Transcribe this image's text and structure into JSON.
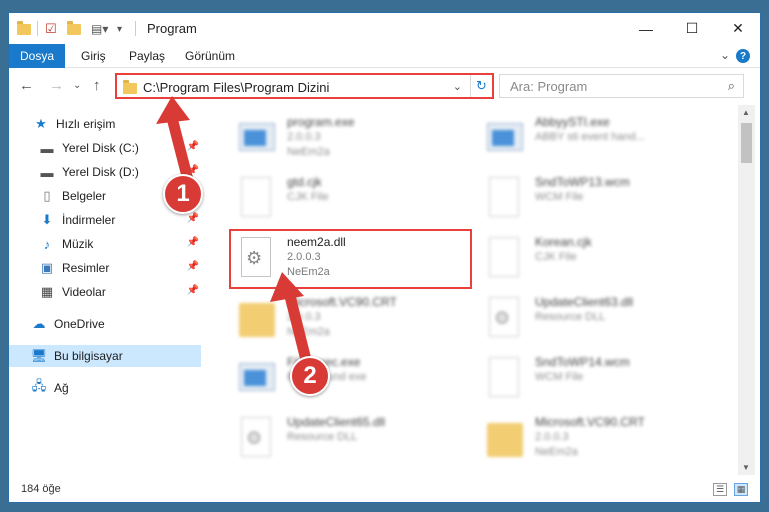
{
  "window": {
    "title": "Program"
  },
  "ribbon": {
    "tabs": [
      "Dosya",
      "Giriş",
      "Paylaş",
      "Görünüm"
    ],
    "help": "?"
  },
  "navbar": {
    "address": "C:\\Program Files\\Program Dizini",
    "search_placeholder": "Ara: Program"
  },
  "sidebar": {
    "items": [
      {
        "label": "Hızlı erişim",
        "icon": "star-icon"
      },
      {
        "label": "Yerel Disk (C:)",
        "icon": "drive-icon"
      },
      {
        "label": "Yerel Disk (D:)",
        "icon": "drive-icon"
      },
      {
        "label": "Belgeler",
        "icon": "document-icon"
      },
      {
        "label": "İndirmeler",
        "icon": "download-icon"
      },
      {
        "label": "Müzik",
        "icon": "music-icon"
      },
      {
        "label": "Resimler",
        "icon": "picture-icon"
      },
      {
        "label": "Videolar",
        "icon": "video-icon"
      },
      {
        "label": "OneDrive",
        "icon": "cloud-icon"
      },
      {
        "label": "Bu bilgisayar",
        "icon": "computer-icon"
      },
      {
        "label": "Ağ",
        "icon": "network-icon"
      }
    ]
  },
  "files": {
    "left": [
      {
        "name": "program.exe",
        "l2": "2.0.0.3",
        "l3": "NeEm2a"
      },
      {
        "name": "gtd.cjk",
        "l2": "CJK File",
        "l3": ""
      },
      {
        "name": "neem2a.dll",
        "l2": "2.0.0.3",
        "l3": "NeEm2a"
      },
      {
        "name": "Microsoft.VC90.CRT",
        "l2": "2.0.0.3",
        "l3": "NeEm2a"
      },
      {
        "name": "Filesexec.exe",
        "l2": "Background exe",
        "l3": ""
      },
      {
        "name": "UpdateClient65.dll",
        "l2": "Resource DLL",
        "l3": ""
      }
    ],
    "right": [
      {
        "name": "AbbyySTI.exe",
        "l2": "ABBY sti event hand...",
        "l3": ""
      },
      {
        "name": "SndToWP13.wcm",
        "l2": "WCM File",
        "l3": ""
      },
      {
        "name": "Korean.cjk",
        "l2": "CJK File",
        "l3": ""
      },
      {
        "name": "UpdateClient63.dll",
        "l2": "Resource DLL",
        "l3": ""
      },
      {
        "name": "SndToWP14.wcm",
        "l2": "WCM File",
        "l3": ""
      },
      {
        "name": "Microsoft.VC90.CRT",
        "l2": "2.0.0.3",
        "l3": "NeEm2a"
      }
    ]
  },
  "status": {
    "count": "184 öğe"
  },
  "annotations": {
    "step1": "1",
    "step2": "2",
    "color": "#d83b36"
  }
}
